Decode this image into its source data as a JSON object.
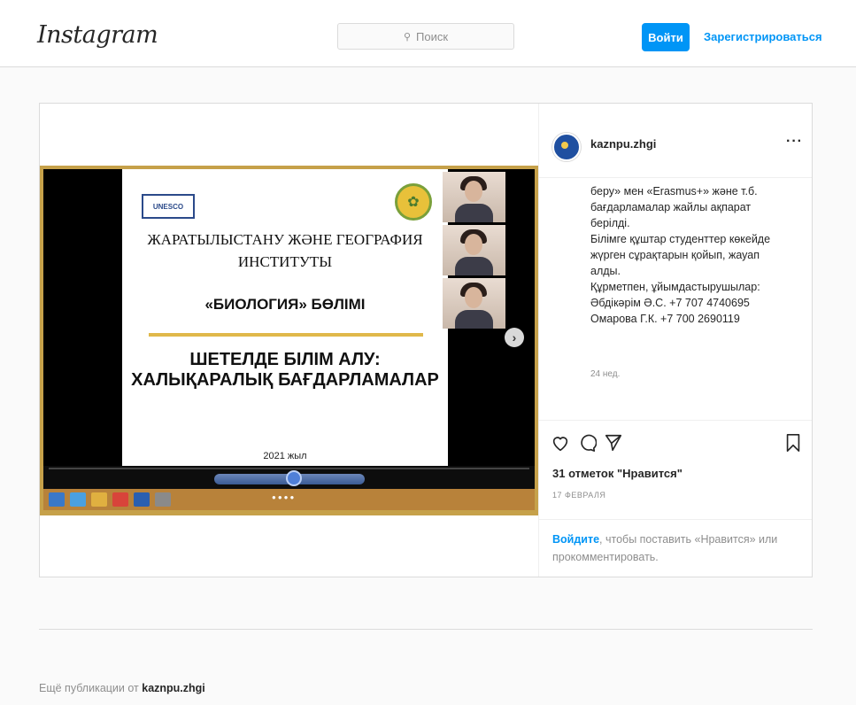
{
  "header": {
    "logo": "Instagram",
    "search_placeholder": "Поиск",
    "login_label": "Войти",
    "signup_label": "Зарегистрироваться"
  },
  "slide": {
    "logo_text": "UNESCO",
    "institute_line1": "ЖАРАТЫЛЫСТАНУ ЖӘНЕ ГЕОГРАФИЯ",
    "institute_line2": "ИНСТИТУТЫ",
    "department": "«БИОЛОГИЯ» БӨЛІМІ",
    "title_line1": "ШЕТЕЛДЕ БІЛІМ АЛУ:",
    "title_line2": "ХАЛЫҚАРАЛЫҚ БАҒДАРЛАМАЛАР",
    "year": "2021 жыл"
  },
  "post": {
    "username": "kaznpu.zhgi",
    "caption_lines": [
      "беру» мен «Erasmus+» және т.б.",
      "бағдарламалар жайлы ақпарат",
      "берілді.",
      "Білімге құштар студенттер көкейде",
      "жүрген сұрақтарын қойып, жауап",
      "алды.",
      "Құрметпен, ұйымдастырушылар:",
      "Әбдікәрім Ә.С. +7 707 4740695",
      "Омарова Г.К. +7 700 2690119"
    ],
    "time_ago": "24 нед.",
    "likes": "31 отметок \"Нравится\"",
    "date": "17 ФЕВРАЛЯ",
    "login_link": "Войдите",
    "login_text": ", чтобы поставить «Нравится» или прокомментировать."
  },
  "footer": {
    "more_prefix": "Ещё публикации от ",
    "more_account": "kaznpu.zhgi"
  },
  "colors": {
    "accent": "#0095f6",
    "border": "#dbdbdb",
    "frame": "#c6a14a"
  },
  "icons": [
    "search-icon",
    "more-options-icon",
    "next-slide-icon",
    "heart-icon",
    "comment-icon",
    "share-icon",
    "bookmark-icon",
    "avatar"
  ]
}
